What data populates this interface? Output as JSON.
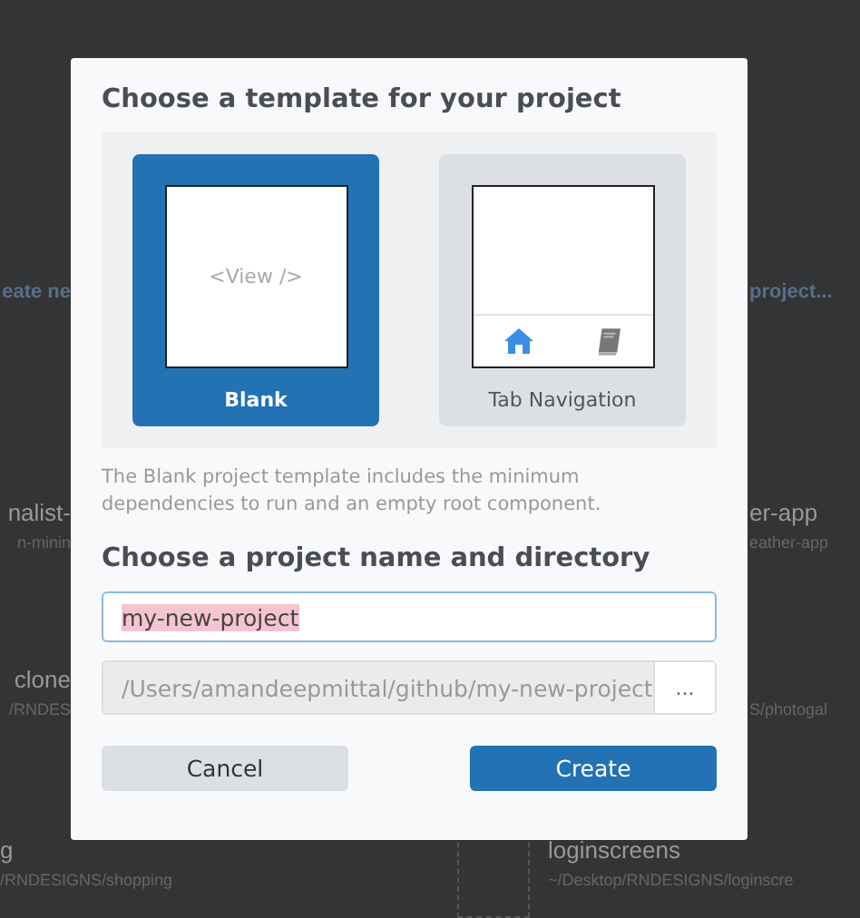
{
  "background": [
    {
      "kind": "link",
      "text": "eate ne"
    },
    {
      "kind": "link",
      "text": "project..."
    },
    {
      "kind": "project",
      "name": "nalist-",
      "path": "n-minin"
    },
    {
      "kind": "project",
      "name": "er-app",
      "path": "eather-app"
    },
    {
      "kind": "project",
      "name": "clone",
      "path": "/RNDES"
    },
    {
      "kind": "project",
      "path": "S/photogal"
    },
    {
      "kind": "project",
      "name": "g",
      "path": "/RNDESIGNS/shopping"
    },
    {
      "kind": "project",
      "name": "loginscreens",
      "path": "~/Desktop/RNDESIGNS/loginscre",
      "thumbnail": true
    }
  ],
  "dialog": {
    "title": "Choose a template for your project",
    "templates": [
      {
        "kind": "blank",
        "label": "Blank",
        "selected": true,
        "preview_text": "<View />"
      },
      {
        "kind": "tabs",
        "label": "Tab Navigation",
        "selected": false
      }
    ],
    "description": "The Blank project template includes the minimum dependencies to run and an empty root component.",
    "name_heading": "Choose a project name and directory",
    "name_field": {
      "value": "my-new-project",
      "selected_text": true
    },
    "directory_field": {
      "value": "/Users/amandeepmittal/github/my-new-project",
      "browse_label": "..."
    },
    "buttons": [
      {
        "kind": "secondary",
        "label": "Cancel"
      },
      {
        "kind": "primary",
        "label": "Create"
      }
    ]
  }
}
